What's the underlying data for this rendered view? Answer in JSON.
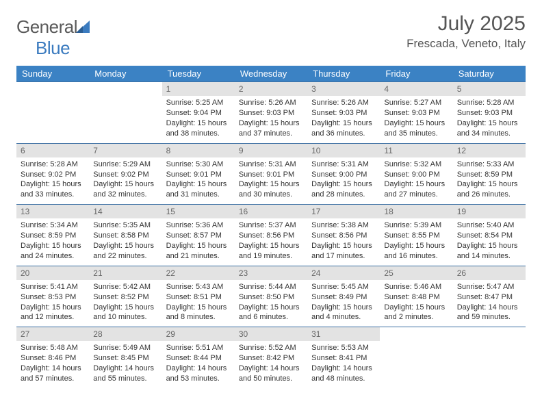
{
  "brand": {
    "name_a": "General",
    "name_b": "Blue"
  },
  "title": "July 2025",
  "location": "Frescada, Veneto, Italy",
  "dow": [
    "Sunday",
    "Monday",
    "Tuesday",
    "Wednesday",
    "Thursday",
    "Friday",
    "Saturday"
  ],
  "labels": {
    "sunrise": "Sunrise:",
    "sunset": "Sunset:",
    "daylight": "Daylight:"
  },
  "weeks": [
    [
      null,
      null,
      {
        "n": "1",
        "sunrise": "5:25 AM",
        "sunset": "9:04 PM",
        "daylight": "15 hours and 38 minutes."
      },
      {
        "n": "2",
        "sunrise": "5:26 AM",
        "sunset": "9:03 PM",
        "daylight": "15 hours and 37 minutes."
      },
      {
        "n": "3",
        "sunrise": "5:26 AM",
        "sunset": "9:03 PM",
        "daylight": "15 hours and 36 minutes."
      },
      {
        "n": "4",
        "sunrise": "5:27 AM",
        "sunset": "9:03 PM",
        "daylight": "15 hours and 35 minutes."
      },
      {
        "n": "5",
        "sunrise": "5:28 AM",
        "sunset": "9:03 PM",
        "daylight": "15 hours and 34 minutes."
      }
    ],
    [
      {
        "n": "6",
        "sunrise": "5:28 AM",
        "sunset": "9:02 PM",
        "daylight": "15 hours and 33 minutes."
      },
      {
        "n": "7",
        "sunrise": "5:29 AM",
        "sunset": "9:02 PM",
        "daylight": "15 hours and 32 minutes."
      },
      {
        "n": "8",
        "sunrise": "5:30 AM",
        "sunset": "9:01 PM",
        "daylight": "15 hours and 31 minutes."
      },
      {
        "n": "9",
        "sunrise": "5:31 AM",
        "sunset": "9:01 PM",
        "daylight": "15 hours and 30 minutes."
      },
      {
        "n": "10",
        "sunrise": "5:31 AM",
        "sunset": "9:00 PM",
        "daylight": "15 hours and 28 minutes."
      },
      {
        "n": "11",
        "sunrise": "5:32 AM",
        "sunset": "9:00 PM",
        "daylight": "15 hours and 27 minutes."
      },
      {
        "n": "12",
        "sunrise": "5:33 AM",
        "sunset": "8:59 PM",
        "daylight": "15 hours and 26 minutes."
      }
    ],
    [
      {
        "n": "13",
        "sunrise": "5:34 AM",
        "sunset": "8:59 PM",
        "daylight": "15 hours and 24 minutes."
      },
      {
        "n": "14",
        "sunrise": "5:35 AM",
        "sunset": "8:58 PM",
        "daylight": "15 hours and 22 minutes."
      },
      {
        "n": "15",
        "sunrise": "5:36 AM",
        "sunset": "8:57 PM",
        "daylight": "15 hours and 21 minutes."
      },
      {
        "n": "16",
        "sunrise": "5:37 AM",
        "sunset": "8:56 PM",
        "daylight": "15 hours and 19 minutes."
      },
      {
        "n": "17",
        "sunrise": "5:38 AM",
        "sunset": "8:56 PM",
        "daylight": "15 hours and 17 minutes."
      },
      {
        "n": "18",
        "sunrise": "5:39 AM",
        "sunset": "8:55 PM",
        "daylight": "15 hours and 16 minutes."
      },
      {
        "n": "19",
        "sunrise": "5:40 AM",
        "sunset": "8:54 PM",
        "daylight": "15 hours and 14 minutes."
      }
    ],
    [
      {
        "n": "20",
        "sunrise": "5:41 AM",
        "sunset": "8:53 PM",
        "daylight": "15 hours and 12 minutes."
      },
      {
        "n": "21",
        "sunrise": "5:42 AM",
        "sunset": "8:52 PM",
        "daylight": "15 hours and 10 minutes."
      },
      {
        "n": "22",
        "sunrise": "5:43 AM",
        "sunset": "8:51 PM",
        "daylight": "15 hours and 8 minutes."
      },
      {
        "n": "23",
        "sunrise": "5:44 AM",
        "sunset": "8:50 PM",
        "daylight": "15 hours and 6 minutes."
      },
      {
        "n": "24",
        "sunrise": "5:45 AM",
        "sunset": "8:49 PM",
        "daylight": "15 hours and 4 minutes."
      },
      {
        "n": "25",
        "sunrise": "5:46 AM",
        "sunset": "8:48 PM",
        "daylight": "15 hours and 2 minutes."
      },
      {
        "n": "26",
        "sunrise": "5:47 AM",
        "sunset": "8:47 PM",
        "daylight": "14 hours and 59 minutes."
      }
    ],
    [
      {
        "n": "27",
        "sunrise": "5:48 AM",
        "sunset": "8:46 PM",
        "daylight": "14 hours and 57 minutes."
      },
      {
        "n": "28",
        "sunrise": "5:49 AM",
        "sunset": "8:45 PM",
        "daylight": "14 hours and 55 minutes."
      },
      {
        "n": "29",
        "sunrise": "5:51 AM",
        "sunset": "8:44 PM",
        "daylight": "14 hours and 53 minutes."
      },
      {
        "n": "30",
        "sunrise": "5:52 AM",
        "sunset": "8:42 PM",
        "daylight": "14 hours and 50 minutes."
      },
      {
        "n": "31",
        "sunrise": "5:53 AM",
        "sunset": "8:41 PM",
        "daylight": "14 hours and 48 minutes."
      },
      null,
      null
    ]
  ]
}
